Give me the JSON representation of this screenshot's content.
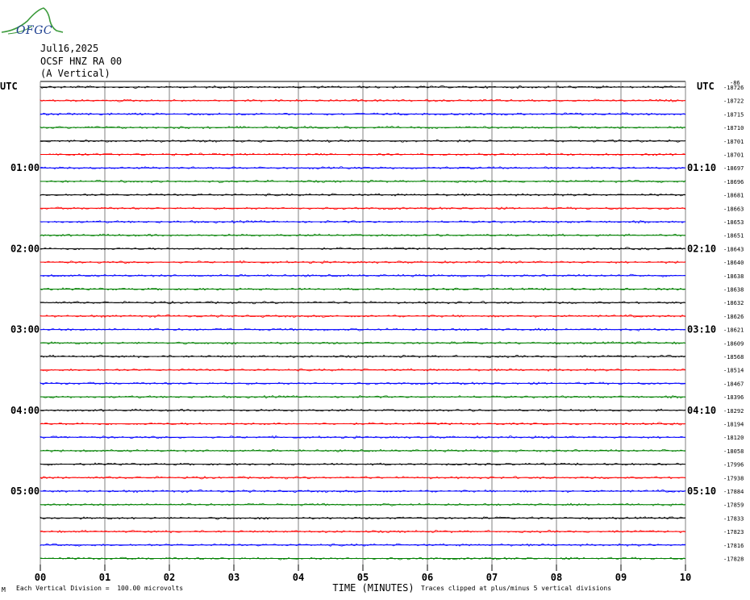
{
  "logo": {
    "text": "OFGC",
    "name": "ofgc-logo"
  },
  "header": {
    "date": "Jul16,2025",
    "station": "OCSF HNZ RA 00",
    "component": "(A Vertical)"
  },
  "colors": {
    "trace_cycle": [
      "#000000",
      "#ff0000",
      "#0000ff",
      "#008000"
    ],
    "grid": "#808080",
    "logo_green": "#3a9a3a",
    "logo_blue": "#1a3d8f"
  },
  "chart_data": {
    "type": "line",
    "title": "",
    "xlabel": "TIME (MINUTES)",
    "ylabel": "",
    "xlim": [
      0,
      10
    ],
    "x_ticks": [
      "00",
      "01",
      "02",
      "03",
      "04",
      "05",
      "06",
      "07",
      "08",
      "09",
      "10"
    ],
    "left_axis_label": "UTC",
    "right_axis_label": "UTC",
    "left_time_labels": [
      "01:00",
      "02:00",
      "03:00",
      "04:00",
      "05:00"
    ],
    "right_time_labels": [
      "01:10",
      "02:10",
      "03:10",
      "04:10",
      "05:10"
    ],
    "trace_count": 36,
    "series": [
      {
        "offset": "-18726"
      },
      {
        "offset": "-18722"
      },
      {
        "offset": "-18715"
      },
      {
        "offset": "-18710"
      },
      {
        "offset": "-18701"
      },
      {
        "offset": "-18701"
      },
      {
        "offset": "-18697"
      },
      {
        "offset": "-18696"
      },
      {
        "offset": "-18681"
      },
      {
        "offset": "-18663"
      },
      {
        "offset": "-18653"
      },
      {
        "offset": "-18651"
      },
      {
        "offset": "-18643"
      },
      {
        "offset": "-18640"
      },
      {
        "offset": "-18638"
      },
      {
        "offset": "-18638"
      },
      {
        "offset": "-18632"
      },
      {
        "offset": "-18626"
      },
      {
        "offset": "-18621"
      },
      {
        "offset": "-18609"
      },
      {
        "offset": "-18568"
      },
      {
        "offset": "-18514"
      },
      {
        "offset": "-18467"
      },
      {
        "offset": "-18396"
      },
      {
        "offset": "-18292"
      },
      {
        "offset": "-18194"
      },
      {
        "offset": "-18120"
      },
      {
        "offset": "-18058"
      },
      {
        "offset": "-17996"
      },
      {
        "offset": "-17938"
      },
      {
        "offset": "-17884"
      },
      {
        "offset": "-17859"
      },
      {
        "offset": "-17833"
      },
      {
        "offset": "-17823"
      },
      {
        "offset": "-17816"
      },
      {
        "offset": "-17828"
      }
    ],
    "top_right_note": "-86",
    "footnote_left": "Each Vertical Division =  100.00 microvolts",
    "footnote_right": "Traces clipped at plus/minus 5 vertical divisions",
    "footnote_prefix": "M"
  }
}
